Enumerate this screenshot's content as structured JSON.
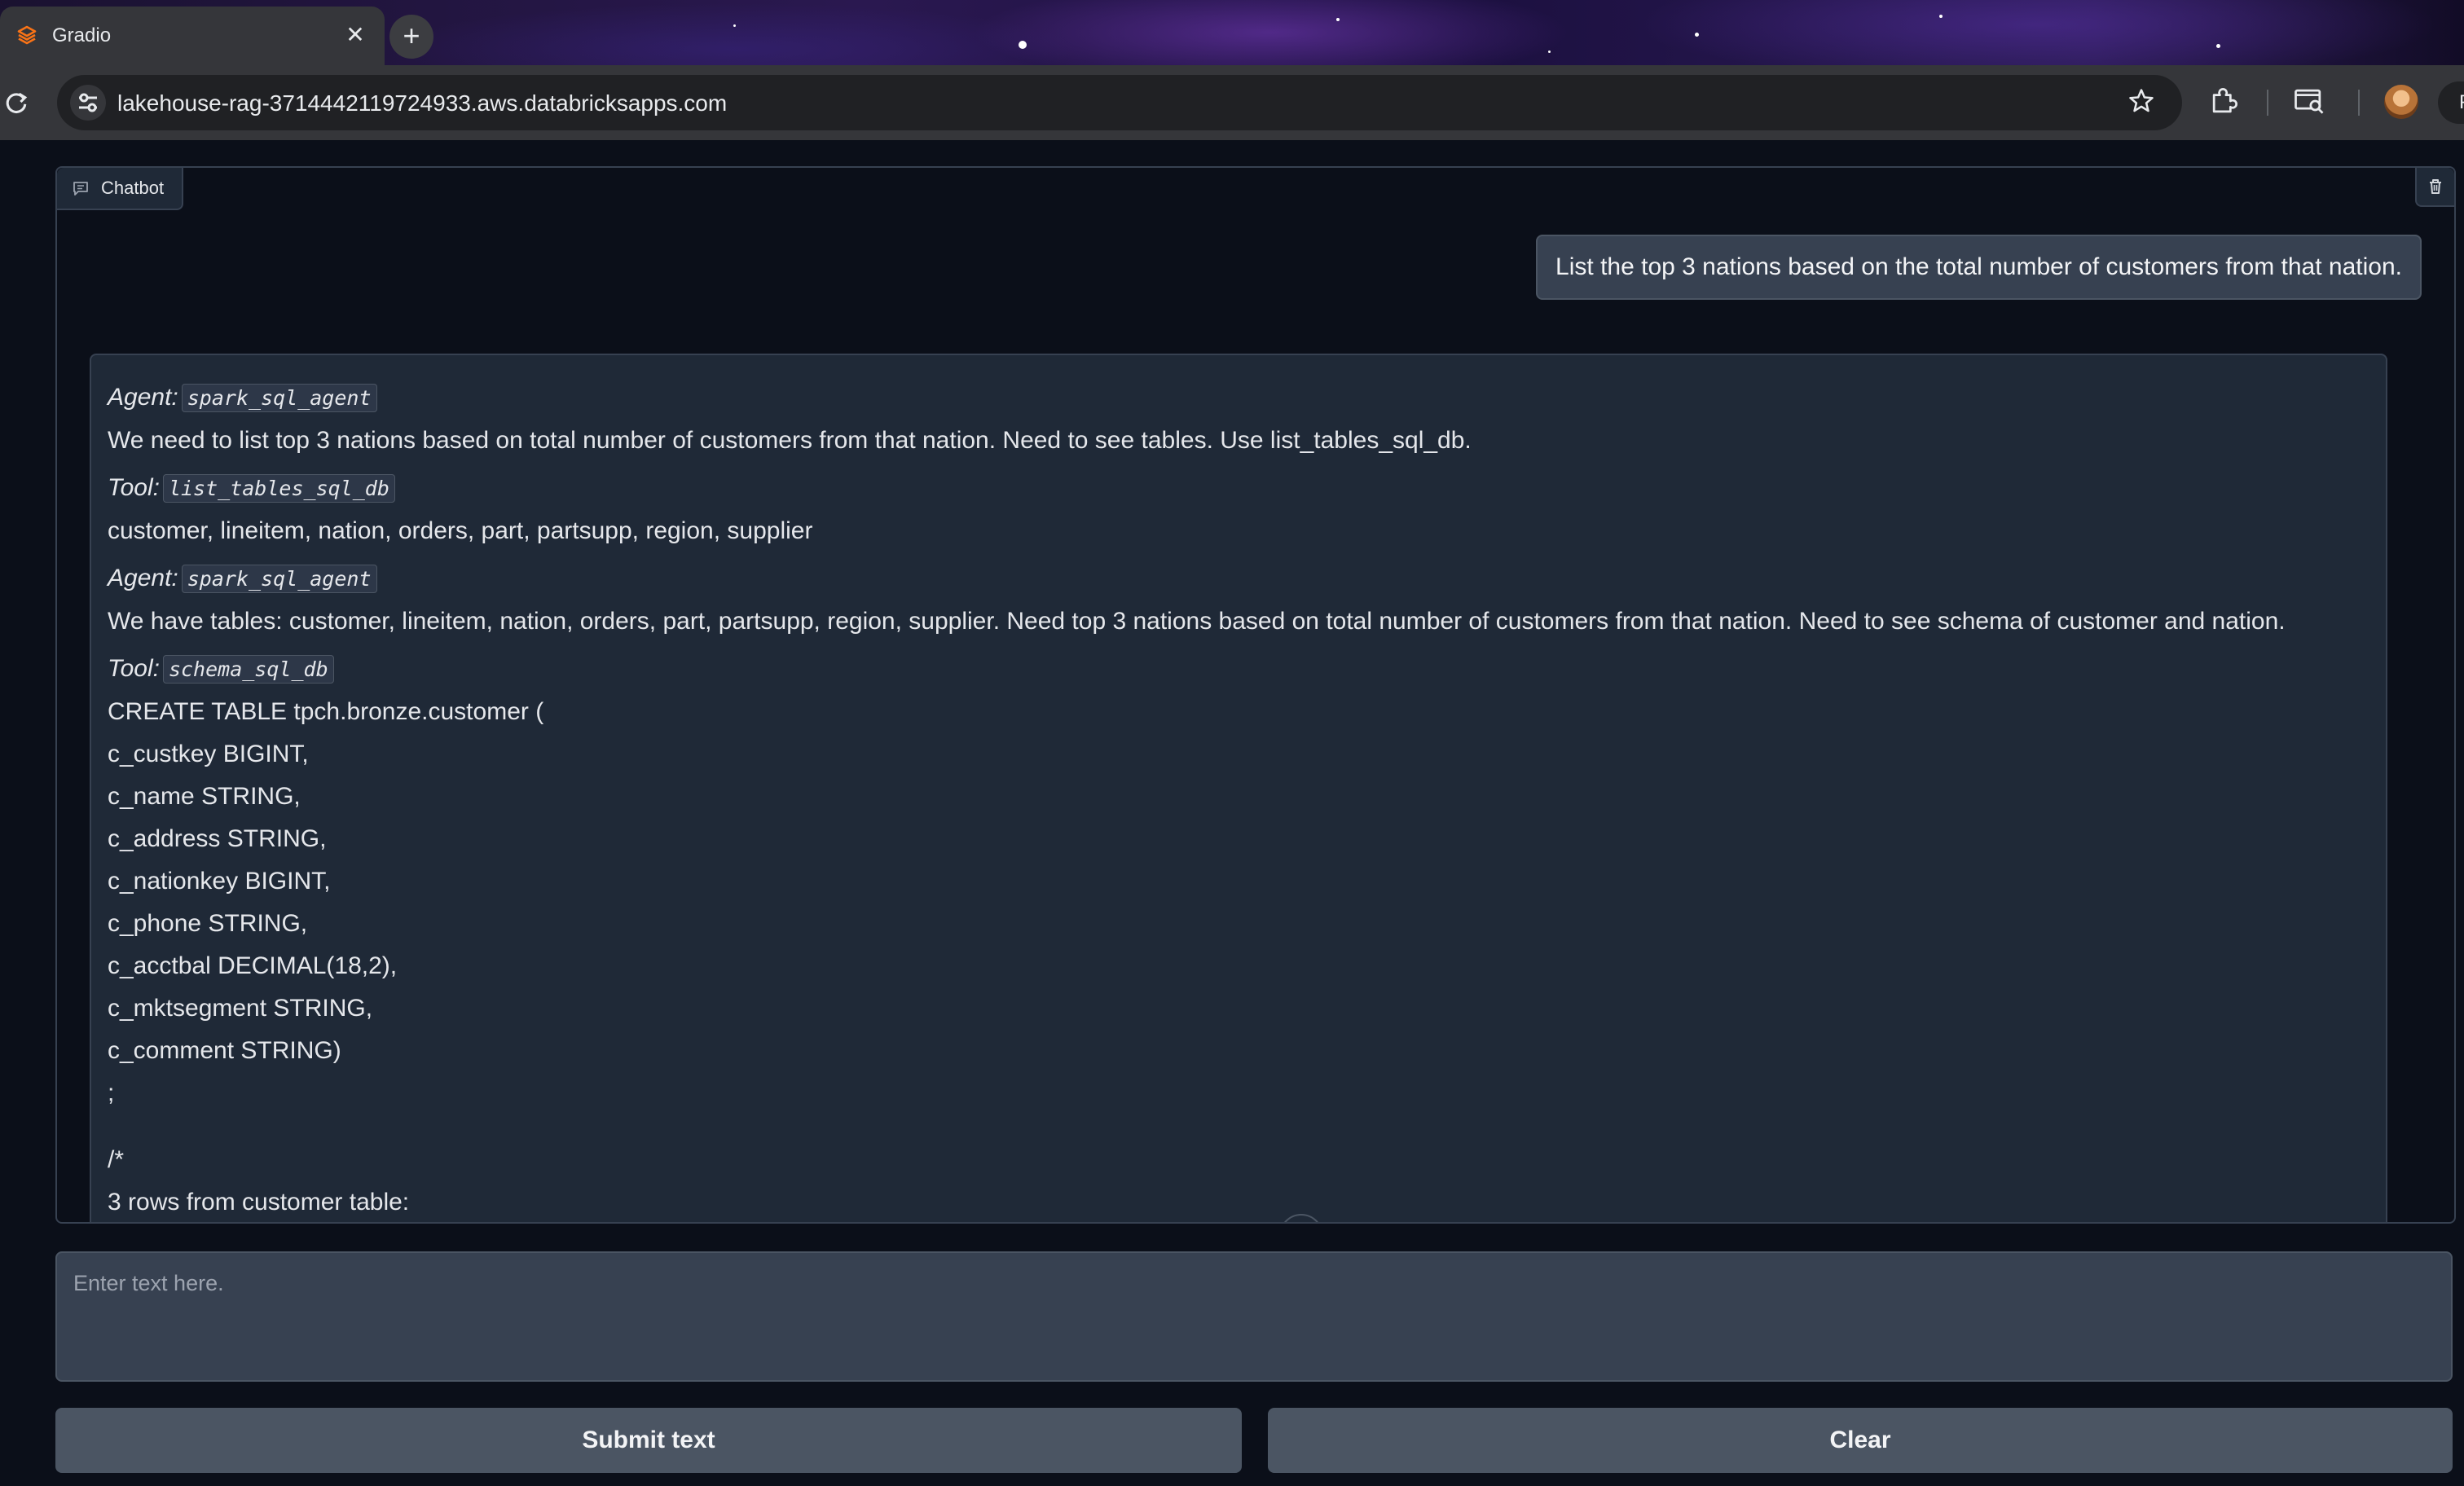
{
  "browser": {
    "tab_title": "Gradio",
    "tab_close": "✕",
    "new_tab": "+",
    "url": "lakehouse-rag-3714442119724933.aws.databricksapps.com",
    "profile_label": "P"
  },
  "chatbot": {
    "label": "Chatbot",
    "user_message": "List the top 3 nations based on the total number of customers from that nation.",
    "bot_lines": {
      "agent1_prefix": "Agent:",
      "agent1_name": "spark_sql_agent",
      "agent1_text": "We need to list top 3 nations based on total number of customers from that nation. Need to see tables. Use list_tables_sql_db.",
      "tool1_prefix": "Tool:",
      "tool1_name": "list_tables_sql_db",
      "tool1_output": "customer, lineitem, nation, orders, part, partsupp, region, supplier",
      "agent2_prefix": "Agent:",
      "agent2_name": "spark_sql_agent",
      "agent2_text": "We have tables: customer, lineitem, nation, orders, part, partsupp, region, supplier. Need top 3 nations based on total number of customers from that nation. Need to see schema of customer and nation.",
      "tool2_prefix": "Tool:",
      "tool2_name": "schema_sql_db",
      "schema": [
        "CREATE TABLE tpch.bronze.customer (",
        "c_custkey BIGINT,",
        "c_name STRING,",
        "c_address STRING,",
        "c_nationkey BIGINT,",
        "c_phone STRING,",
        "c_acctbal DECIMAL(18,2),",
        "c_mktsegment STRING,",
        "c_comment STRING)",
        ";"
      ],
      "comment_open": "/*",
      "rows_caption": "3 rows from customer table:"
    }
  },
  "input": {
    "placeholder": "Enter text here."
  },
  "buttons": {
    "submit": "Submit text",
    "clear": "Clear"
  },
  "icons": {
    "favicon": "gradio-logo-icon",
    "scroll": "arrow-down-icon",
    "trash": "trash-icon"
  },
  "colors": {
    "background": "#0b0f19",
    "bubble": "#1f2937",
    "user_bubble": "#374151",
    "button": "#4b5563",
    "favicon": "#f97316"
  }
}
